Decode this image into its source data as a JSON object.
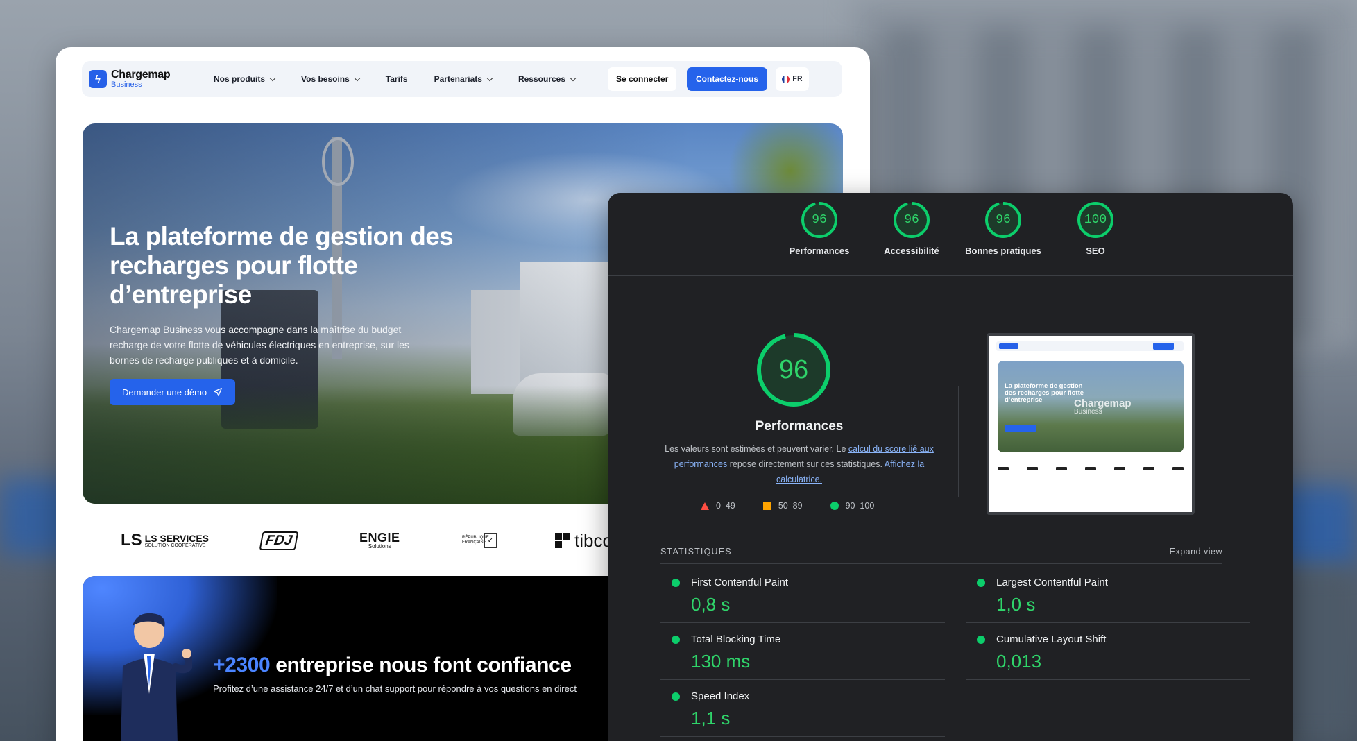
{
  "site": {
    "brand": {
      "name": "Chargemap",
      "sub": "Business"
    },
    "nav": [
      {
        "label": "Nos produits",
        "dropdown": true
      },
      {
        "label": "Vos besoins",
        "dropdown": true
      },
      {
        "label": "Tarifs",
        "dropdown": false
      },
      {
        "label": "Partenariats",
        "dropdown": true
      },
      {
        "label": "Ressources",
        "dropdown": true
      }
    ],
    "login_label": "Se connecter",
    "contact_label": "Contactez-nous",
    "lang": "FR",
    "hero": {
      "title": "La plateforme de gestion des recharges pour flotte d’entreprise",
      "description": "Chargemap Business vous accompagne dans la maîtrise du budget recharge de votre flotte de véhicules électriques en entreprise, sur les bornes de recharge publiques et à domicile.",
      "cta": "Demander une démo"
    },
    "partners": {
      "ls_title": "LS SERVICES",
      "ls_sub": "SOLUTION COOPÉRATIVE",
      "fdj": "FDJ",
      "engie_title": "ENGIE",
      "engie_sub": "Solutions",
      "rf_text": "RÉPUBLIQUE FRANÇAISE",
      "tibco": "tibco"
    },
    "trust": {
      "count": "+2300",
      "title": "entreprise nous font confiance",
      "subtitle": "Profitez d’une assistance 24/7 et d’un chat support pour répondre à vos questions en direct"
    }
  },
  "lighthouse": {
    "scores": [
      {
        "label": "Performances",
        "value": "96",
        "score": 0.96
      },
      {
        "label": "Accessibilité",
        "value": "96",
        "score": 0.96
      },
      {
        "label": "Bonnes pratiques",
        "value": "96",
        "score": 0.96
      },
      {
        "label": "SEO",
        "value": "100",
        "score": 1.0
      }
    ],
    "main": {
      "value": "96",
      "score": 0.96,
      "title": "Performances",
      "desc_pre": "Les valeurs sont estimées et peuvent varier. Le ",
      "desc_link1": "calcul du score lié aux performances",
      "desc_mid": " repose directement sur ces statistiques. ",
      "desc_link2": "Affichez la calculatrice."
    },
    "legend": [
      {
        "range": "0–49",
        "color": "#ff4e42"
      },
      {
        "range": "50–89",
        "color": "#ffa400"
      },
      {
        "range": "90–100",
        "color": "#0cce6b"
      }
    ],
    "thumbnail": {
      "title": "La plateforme de gestion des recharges pour flotte d’entreprise",
      "brand": "Chargemap",
      "brand_sub": "Business"
    },
    "stats_label": "STATISTIQUES",
    "expand_label": "Expand view",
    "metrics": [
      {
        "name": "First Contentful Paint",
        "value": "0,8 s"
      },
      {
        "name": "Largest Contentful Paint",
        "value": "1,0 s"
      },
      {
        "name": "Total Blocking Time",
        "value": "130 ms"
      },
      {
        "name": "Cumulative Layout Shift",
        "value": "0,013"
      },
      {
        "name": "Speed Index",
        "value": "1,1 s"
      }
    ]
  },
  "colors": {
    "brand_blue": "#2563eb",
    "pass_green": "#0cce6b",
    "panel_bg": "#202124"
  }
}
